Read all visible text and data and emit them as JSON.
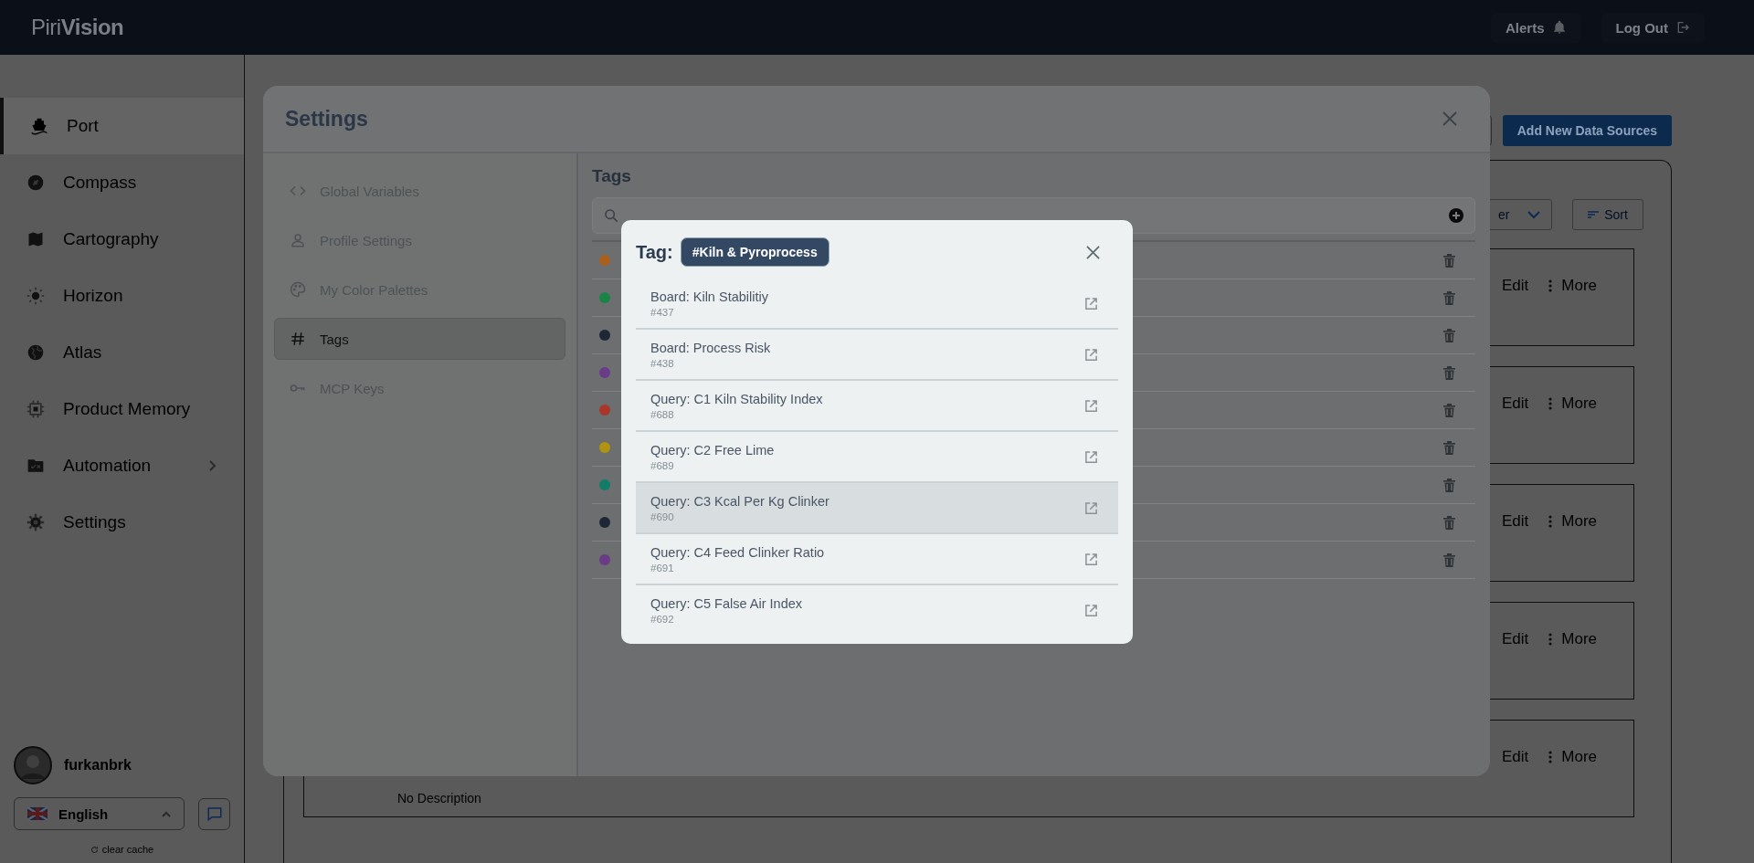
{
  "header": {
    "logo": "Piri**Vision**",
    "alerts": "Alerts",
    "logout": "Log Out"
  },
  "sidebar": {
    "items": [
      {
        "label": "Port",
        "selected": true,
        "expandable": false
      },
      {
        "label": "Compass",
        "selected": false,
        "expandable": false
      },
      {
        "label": "Cartography",
        "selected": false,
        "expandable": false
      },
      {
        "label": "Horizon",
        "selected": false,
        "expandable": false
      },
      {
        "label": "Atlas",
        "selected": false,
        "expandable": false
      },
      {
        "label": "Product Memory",
        "selected": false,
        "expandable": false
      },
      {
        "label": "Automation",
        "selected": false,
        "expandable": true
      },
      {
        "label": "Settings",
        "selected": false,
        "expandable": false
      }
    ],
    "user": "furkanbrk",
    "language": "English",
    "clear_cache": "clear cache"
  },
  "page": {
    "add_button": "Add New Data Sources",
    "filter": "er",
    "sort": "Sort",
    "cards": [
      {
        "edit": "Edit",
        "more": "More"
      },
      {
        "edit": "Edit",
        "more": "More"
      },
      {
        "edit": "Edit",
        "more": "More"
      },
      {
        "edit": "Edit",
        "more": "More"
      },
      {
        "edit": "Edit",
        "more": "More",
        "description": "No Description"
      }
    ]
  },
  "settings": {
    "title": "Settings",
    "nav": [
      {
        "label": "Global Variables",
        "selected": false
      },
      {
        "label": "Profile Settings",
        "selected": false
      },
      {
        "label": "My Color Palettes",
        "selected": false
      },
      {
        "label": "Tags",
        "selected": true
      },
      {
        "label": "MCP Keys",
        "selected": false
      }
    ],
    "section_title": "Tags",
    "tags": [
      {
        "color": "#a9601c"
      },
      {
        "color": "#1a8447"
      },
      {
        "color": "#1e2735"
      },
      {
        "color": "#6a3b86"
      },
      {
        "color": "#ab3528"
      },
      {
        "color": "#b0930e"
      },
      {
        "color": "#0f7d68"
      },
      {
        "color": "#1e2735"
      },
      {
        "color": "#6a3b86"
      }
    ]
  },
  "tag_dialog": {
    "label": "Tag:",
    "tag": "#Kiln & Pyroprocess",
    "items": [
      {
        "title": "Board: Kiln Stabilitiy",
        "id": "#437",
        "hovered": false
      },
      {
        "title": "Board: Process Risk",
        "id": "#438",
        "hovered": false
      },
      {
        "title": "Query: C1 Kiln Stability Index",
        "id": "#688",
        "hovered": false
      },
      {
        "title": "Query: C2 Free Lime",
        "id": "#689",
        "hovered": false
      },
      {
        "title": "Query: C3 Kcal Per Kg Clinker",
        "id": "#690",
        "hovered": true
      },
      {
        "title": "Query: C4 Feed Clinker Ratio",
        "id": "#691",
        "hovered": false
      },
      {
        "title": "Query: C5 False Air Index",
        "id": "#692",
        "hovered": false
      }
    ]
  }
}
